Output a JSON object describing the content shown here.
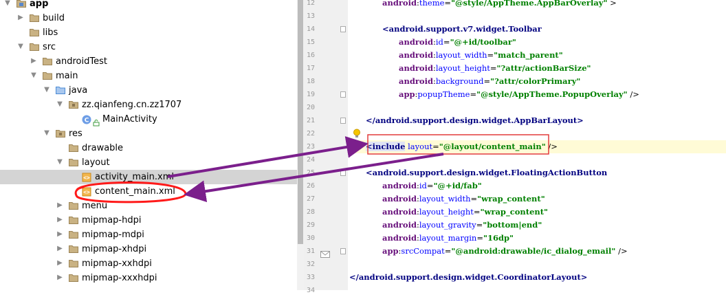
{
  "project_tree": {
    "items": [
      {
        "label": "app",
        "indent": 0,
        "arrow": "down",
        "icon": "module",
        "bold": true
      },
      {
        "label": "build",
        "indent": 1,
        "arrow": "right",
        "icon": "folder"
      },
      {
        "label": "libs",
        "indent": 1,
        "arrow": "none",
        "icon": "folder"
      },
      {
        "label": "src",
        "indent": 1,
        "arrow": "down",
        "icon": "folder"
      },
      {
        "label": "androidTest",
        "indent": 2,
        "arrow": "right",
        "icon": "folder"
      },
      {
        "label": "main",
        "indent": 2,
        "arrow": "down",
        "icon": "folder"
      },
      {
        "label": "java",
        "indent": 3,
        "arrow": "down",
        "icon": "src-folder"
      },
      {
        "label": "zz.qianfeng.cn.zz1707",
        "indent": 4,
        "arrow": "down",
        "icon": "package"
      },
      {
        "label": "MainActivity",
        "indent": 5,
        "arrow": "none",
        "icon": "class"
      },
      {
        "label": "res",
        "indent": 3,
        "arrow": "down",
        "icon": "res-folder"
      },
      {
        "label": "drawable",
        "indent": 4,
        "arrow": "none",
        "icon": "folder"
      },
      {
        "label": "layout",
        "indent": 4,
        "arrow": "down",
        "icon": "folder"
      },
      {
        "label": "activity_main.xml",
        "indent": 5,
        "arrow": "none",
        "icon": "xml",
        "selected": true
      },
      {
        "label": "content_main.xml",
        "indent": 5,
        "arrow": "none",
        "icon": "xml"
      },
      {
        "label": "menu",
        "indent": 4,
        "arrow": "right",
        "icon": "folder"
      },
      {
        "label": "mipmap-hdpi",
        "indent": 4,
        "arrow": "right",
        "icon": "folder"
      },
      {
        "label": "mipmap-mdpi",
        "indent": 4,
        "arrow": "right",
        "icon": "folder"
      },
      {
        "label": "mipmap-xhdpi",
        "indent": 4,
        "arrow": "right",
        "icon": "folder"
      },
      {
        "label": "mipmap-xxhdpi",
        "indent": 4,
        "arrow": "right",
        "icon": "folder"
      },
      {
        "label": "mipmap-xxxhdpi",
        "indent": 4,
        "arrow": "right",
        "icon": "folder"
      }
    ]
  },
  "editor": {
    "current_line": "23",
    "lines": [
      {
        "num": "12",
        "indent": 2,
        "tokens": [
          [
            "ns",
            "android"
          ],
          [
            "pl",
            ":"
          ],
          [
            "at",
            "theme"
          ],
          [
            "pl",
            "="
          ],
          [
            "vl",
            "\"@style/AppTheme.AppBarOverlay\""
          ],
          [
            "pl",
            " >"
          ]
        ]
      },
      {
        "num": "13",
        "indent": 0,
        "tokens": []
      },
      {
        "num": "14",
        "indent": 2,
        "tokens": [
          [
            "tg",
            "<android.support.v7.widget.Toolbar"
          ]
        ]
      },
      {
        "num": "15",
        "indent": 3,
        "tokens": [
          [
            "ns",
            "android"
          ],
          [
            "pl",
            ":"
          ],
          [
            "at",
            "id"
          ],
          [
            "pl",
            "="
          ],
          [
            "vl",
            "\"@+id/toolbar\""
          ]
        ]
      },
      {
        "num": "16",
        "indent": 3,
        "tokens": [
          [
            "ns",
            "android"
          ],
          [
            "pl",
            ":"
          ],
          [
            "at",
            "layout_width"
          ],
          [
            "pl",
            "="
          ],
          [
            "vl",
            "\"match_parent\""
          ]
        ]
      },
      {
        "num": "17",
        "indent": 3,
        "tokens": [
          [
            "ns",
            "android"
          ],
          [
            "pl",
            ":"
          ],
          [
            "at",
            "layout_height"
          ],
          [
            "pl",
            "="
          ],
          [
            "vl",
            "\"?attr/actionBarSize\""
          ]
        ]
      },
      {
        "num": "18",
        "indent": 3,
        "tokens": [
          [
            "ns",
            "android"
          ],
          [
            "pl",
            ":"
          ],
          [
            "at",
            "background"
          ],
          [
            "pl",
            "="
          ],
          [
            "vl",
            "\"?attr/colorPrimary\""
          ]
        ]
      },
      {
        "num": "19",
        "indent": 3,
        "tokens": [
          [
            "ns",
            "app"
          ],
          [
            "pl",
            ":"
          ],
          [
            "at",
            "popupTheme"
          ],
          [
            "pl",
            "="
          ],
          [
            "vl",
            "\"@style/AppTheme.PopupOverlay\""
          ],
          [
            "pl",
            " />"
          ]
        ]
      },
      {
        "num": "20",
        "indent": 0,
        "tokens": []
      },
      {
        "num": "21",
        "indent": 1,
        "tokens": [
          [
            "tg",
            "</android.support.design.widget.AppBarLayout>"
          ]
        ]
      },
      {
        "num": "22",
        "indent": 0,
        "tokens": []
      },
      {
        "num": "23",
        "indent": 1,
        "tokens": [
          [
            "tg hl",
            "<include"
          ],
          [
            "pl",
            " "
          ],
          [
            "at",
            "layout"
          ],
          [
            "pl",
            "="
          ],
          [
            "vl",
            "\"@layout/content_main\""
          ],
          [
            "pl",
            " />"
          ]
        ]
      },
      {
        "num": "24",
        "indent": 0,
        "tokens": []
      },
      {
        "num": "25",
        "indent": 1,
        "tokens": [
          [
            "tg",
            "<android.support.design.widget.FloatingActionButton"
          ]
        ]
      },
      {
        "num": "26",
        "indent": 2,
        "tokens": [
          [
            "ns",
            "android"
          ],
          [
            "pl",
            ":"
          ],
          [
            "at",
            "id"
          ],
          [
            "pl",
            "="
          ],
          [
            "vl",
            "\"@+id/fab\""
          ]
        ]
      },
      {
        "num": "27",
        "indent": 2,
        "tokens": [
          [
            "ns",
            "android"
          ],
          [
            "pl",
            ":"
          ],
          [
            "at",
            "layout_width"
          ],
          [
            "pl",
            "="
          ],
          [
            "vl",
            "\"wrap_content\""
          ]
        ]
      },
      {
        "num": "28",
        "indent": 2,
        "tokens": [
          [
            "ns",
            "android"
          ],
          [
            "pl",
            ":"
          ],
          [
            "at",
            "layout_height"
          ],
          [
            "pl",
            "="
          ],
          [
            "vl",
            "\"wrap_content\""
          ]
        ]
      },
      {
        "num": "29",
        "indent": 2,
        "tokens": [
          [
            "ns",
            "android"
          ],
          [
            "pl",
            ":"
          ],
          [
            "at",
            "layout_gravity"
          ],
          [
            "pl",
            "="
          ],
          [
            "vl",
            "\"bottom|end\""
          ]
        ]
      },
      {
        "num": "30",
        "indent": 2,
        "tokens": [
          [
            "ns",
            "android"
          ],
          [
            "pl",
            ":"
          ],
          [
            "at",
            "layout_margin"
          ],
          [
            "pl",
            "="
          ],
          [
            "vl",
            "\"16dp\""
          ]
        ]
      },
      {
        "num": "31",
        "indent": 2,
        "tokens": [
          [
            "ns",
            "app"
          ],
          [
            "pl",
            ":"
          ],
          [
            "at",
            "srcCompat"
          ],
          [
            "pl",
            "="
          ],
          [
            "vl",
            "\"@android:drawable/ic_dialog_email\""
          ],
          [
            "pl",
            " />"
          ]
        ]
      },
      {
        "num": "32",
        "indent": 0,
        "tokens": []
      },
      {
        "num": "33",
        "indent": 0,
        "tokens": [
          [
            "tg",
            "</android.support.design.widget.CoordinatorLayout>"
          ]
        ]
      },
      {
        "num": "34",
        "indent": 0,
        "tokens": []
      }
    ]
  },
  "colors": {
    "annotation_arrow": "#7b1f8c",
    "annotation_circle": "#ff1a1a",
    "annotation_box": "#e23b3b",
    "selection_row": "#d4d4d4"
  },
  "icons": {
    "module": "module-folder-icon",
    "folder": "folder-icon",
    "src-folder": "source-folder-icon",
    "res-folder": "resource-folder-icon",
    "package": "package-icon",
    "class": "class-c-icon",
    "xml": "xml-file-icon"
  }
}
